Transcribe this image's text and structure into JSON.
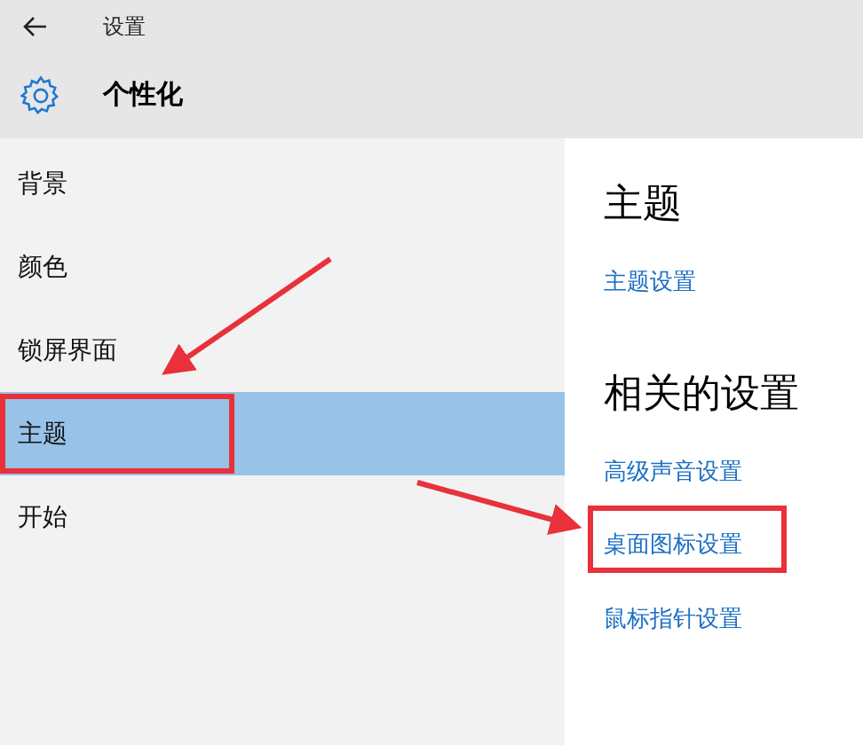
{
  "window": {
    "title": "设置"
  },
  "page": {
    "title": "个性化"
  },
  "sidebar": {
    "items": [
      {
        "label": "背景",
        "selected": false
      },
      {
        "label": "颜色",
        "selected": false
      },
      {
        "label": "锁屏界面",
        "selected": false
      },
      {
        "label": "主题",
        "selected": true
      },
      {
        "label": "开始",
        "selected": false
      }
    ]
  },
  "sections": [
    {
      "heading": "主题",
      "links": [
        "主题设置"
      ]
    },
    {
      "heading": "相关的设置",
      "links": [
        "高级声音设置",
        "桌面图标设置",
        "鼠标指针设置"
      ]
    }
  ]
}
